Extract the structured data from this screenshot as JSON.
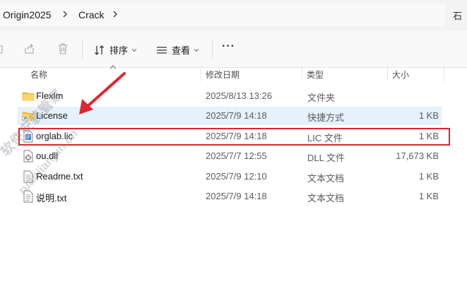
{
  "breadcrumb": {
    "items": [
      "Origin2025",
      "Crack"
    ],
    "right_clip": "石"
  },
  "toolbar": {
    "sort_label": "排序",
    "view_label": "查看",
    "more_label": "···"
  },
  "columns": {
    "name": "名称",
    "date": "修改日期",
    "type": "类型",
    "size": "大小"
  },
  "files": [
    {
      "name": "Flexlm",
      "date": "2025/8/13 13:26",
      "type": "文件夹",
      "size": "",
      "icon": "folder-icon"
    },
    {
      "name": "License",
      "date": "2025/7/9 14:18",
      "type": "快捷方式",
      "size": "1 KB",
      "icon": "folder-shortcut-icon"
    },
    {
      "name": "orglab.lic",
      "date": "2025/7/9 14:18",
      "type": "LIC 文件",
      "size": "1 KB",
      "icon": "lic-file-icon"
    },
    {
      "name": "ou.dll",
      "date": "2025/7/7 12:55",
      "type": "DLL 文件",
      "size": "17,673 KB",
      "icon": "dll-file-icon"
    },
    {
      "name": "Readme.txt",
      "date": "2025/7/9 12:10",
      "type": "文本文档",
      "size": "1 KB",
      "icon": "text-file-icon"
    },
    {
      "name": "说明.txt",
      "date": "2025/7/9 14:18",
      "type": "文本文档",
      "size": "1 KB",
      "icon": "text-file-icon"
    }
  ],
  "watermark": {
    "line1": "软件安装管家",
    "line2": "ruanjianjun.cn"
  },
  "colors": {
    "highlight": "#d9262f",
    "selected_row": "#e5f1fb",
    "folder": "#f4c542"
  }
}
